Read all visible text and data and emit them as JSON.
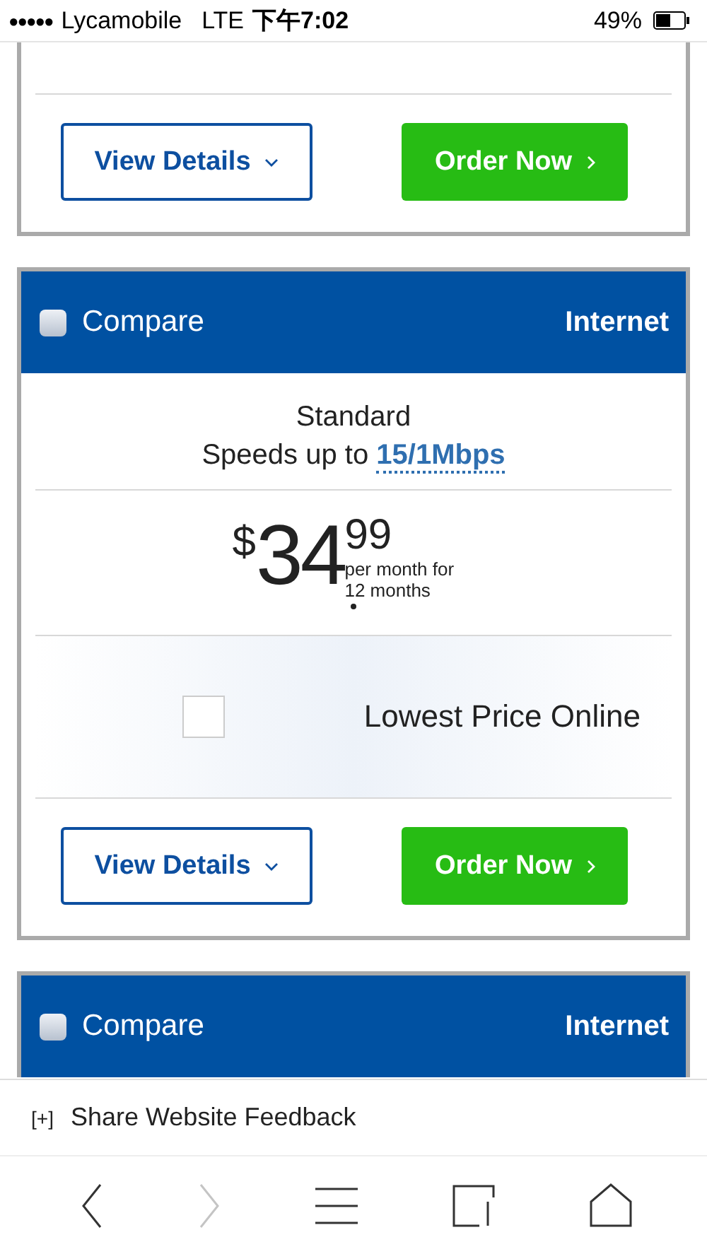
{
  "status_bar": {
    "signal": "●●●●●",
    "carrier": "Lycamobile",
    "network": "LTE",
    "time": "下午7:02",
    "battery": "49%"
  },
  "cards": [
    {
      "buttons": {
        "details": "View Details",
        "order": "Order Now"
      }
    },
    {
      "header": {
        "compare": "Compare",
        "compare_checked": false,
        "category": "Internet"
      },
      "plan": "Standard",
      "speed_prefix": "Speeds up to",
      "speed": "15/1Mbps",
      "price": {
        "currency": "$",
        "dollars": "34",
        "cents": "99",
        "term": "per month for 12 months"
      },
      "feature": {
        "label": "Lowest Price Online",
        "checked": false
      },
      "buttons": {
        "details": "View Details",
        "order": "Order Now"
      }
    },
    {
      "header": {
        "compare": "Compare",
        "compare_checked": false,
        "category": "Internet"
      }
    }
  ],
  "feedback": {
    "marker": "[+]",
    "label": "Share Website Feedback"
  },
  "toolbar": [
    {
      "kind": "back",
      "disabled": false
    },
    {
      "kind": "forward",
      "disabled": true
    },
    {
      "kind": "menu",
      "disabled": false
    },
    {
      "kind": "tabs",
      "disabled": false
    },
    {
      "kind": "home",
      "disabled": false
    }
  ]
}
